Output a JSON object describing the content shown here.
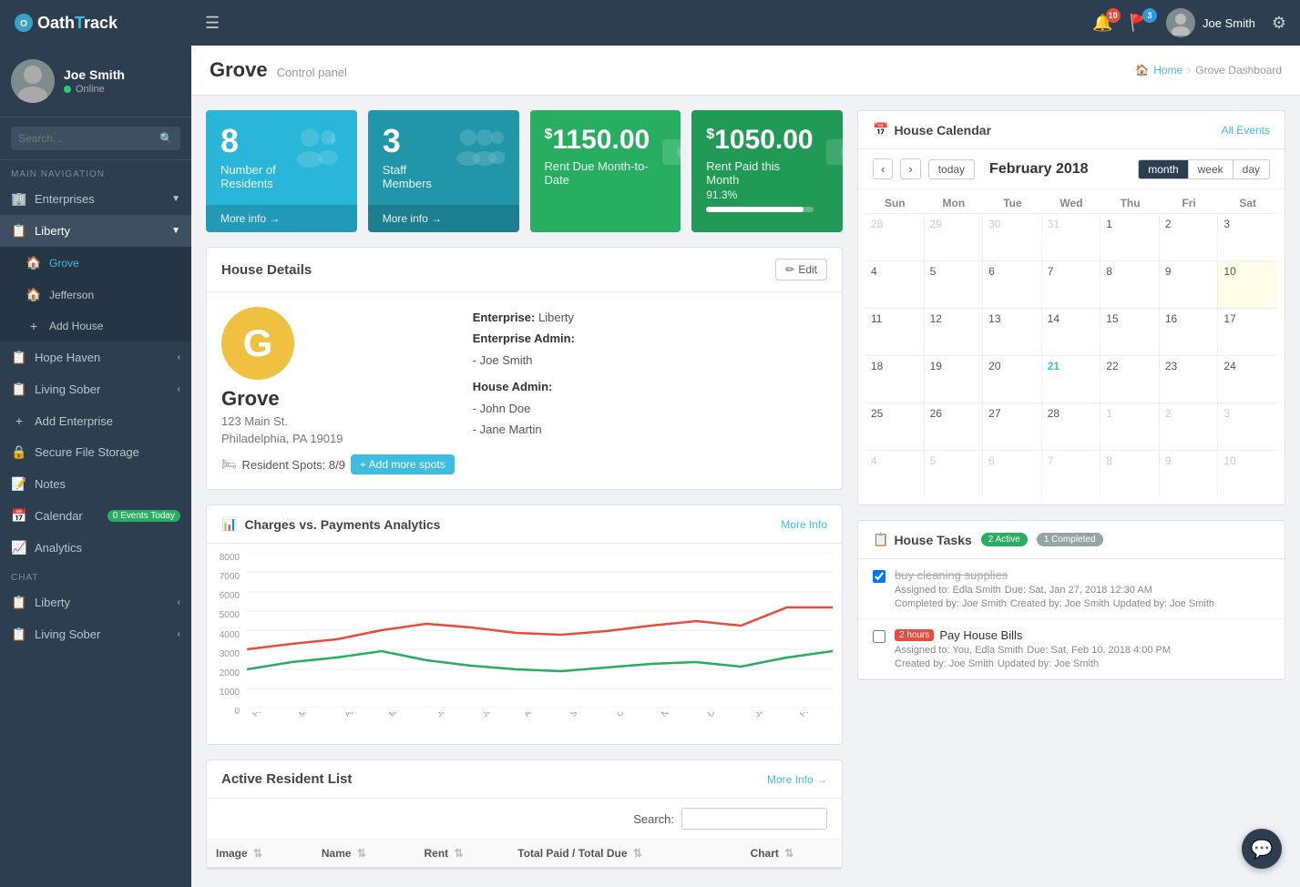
{
  "brand": {
    "oath": "Oath",
    "separator": "T",
    "track": "rack"
  },
  "topnav": {
    "hamburger": "☰",
    "notif_count": "10",
    "flag_count": "3",
    "user_name": "Joe Smith",
    "settings_icon": "⚙"
  },
  "sidebar": {
    "user": {
      "name": "Joe Smith",
      "status": "Online"
    },
    "search_placeholder": "Search...",
    "main_nav_label": "MAIN NAVIGATION",
    "items": [
      {
        "id": "enterprises",
        "label": "Enterprises",
        "icon": "🏢",
        "has_arrow": true
      },
      {
        "id": "liberty",
        "label": "Liberty",
        "icon": "📋",
        "has_arrow": true,
        "active": true
      },
      {
        "id": "grove",
        "label": "Grove",
        "icon": "🏠",
        "sub": true,
        "active_sub": true
      },
      {
        "id": "jefferson",
        "label": "Jefferson",
        "icon": "🏠",
        "sub": true
      },
      {
        "id": "add-house",
        "label": "Add House",
        "icon": "+",
        "sub": true
      },
      {
        "id": "hope-haven",
        "label": "Hope Haven",
        "icon": "📋",
        "has_arrow": true
      },
      {
        "id": "living-sober",
        "label": "Living Sober",
        "icon": "📋",
        "has_arrow": true
      },
      {
        "id": "add-enterprise",
        "label": "Add Enterprise",
        "icon": "+"
      }
    ],
    "secure_file": "Secure File Storage",
    "notes": "Notes",
    "calendar": "Calendar",
    "calendar_badge": "0 Events Today",
    "analytics": "Analytics",
    "chat_label": "Chat",
    "chat_items": [
      {
        "id": "liberty-chat",
        "label": "Liberty",
        "icon": "📋",
        "has_arrow": true
      },
      {
        "id": "living-sober-chat",
        "label": "Living Sober",
        "icon": "📋",
        "has_arrow": true
      }
    ]
  },
  "main_header": {
    "title": "Grove",
    "subtitle": "Control panel",
    "breadcrumb_home": "Home",
    "breadcrumb_current": "Grove Dashboard"
  },
  "stat_cards": [
    {
      "number": "8",
      "label": "Number of Residents",
      "footer": "More info →",
      "color": "blue"
    },
    {
      "number": "3",
      "label": "Staff Members",
      "footer": "More info →",
      "color": "blue-dark"
    },
    {
      "dollar": "$",
      "amount": "1150.00",
      "label": "Rent Due Month-to-Date",
      "color": "green"
    },
    {
      "dollar": "$",
      "amount": "1050.00",
      "label": "Rent Paid this Month",
      "pct": "91.3%",
      "progress": 91.3,
      "color": "green-dark"
    }
  ],
  "house_details": {
    "title": "House Details",
    "edit_label": "Edit",
    "logo_letter": "G",
    "house_name": "Grove",
    "address1": "123 Main St.",
    "address2": "Philadelphia, PA 19019",
    "enterprise_label": "Enterprise:",
    "enterprise_value": "Liberty",
    "enterprise_admin_label": "Enterprise Admin:",
    "enterprise_admin1": "- Joe Smith",
    "house_admin_label": "House Admin:",
    "house_admin1": "- John Doe",
    "house_admin2": "- Jane Martin",
    "spots_label": "Resident Spots: 8/9",
    "add_spots_label": "+ Add more spots"
  },
  "chart": {
    "title": "Charges vs. Payments Analytics",
    "more_info": "More Info",
    "y_labels": [
      "8000",
      "7000",
      "6000",
      "5000",
      "4000",
      "3000",
      "2000",
      "1000",
      "0"
    ],
    "x_labels": [
      "Feb 2017",
      "Mar 2017",
      "Apr 2017",
      "May 2017",
      "Jun 2017",
      "Jul 2017",
      "Aug 2017",
      "Sep 2017",
      "Oct 2017",
      "Nov 2017",
      "Dec 2017",
      "Jan 2018",
      "Feb 2018"
    ]
  },
  "resident_list": {
    "title": "Active Resident List",
    "more_info": "More Info →",
    "search_label": "Search:",
    "columns": [
      "Image",
      "Name",
      "Rent",
      "Total Paid / Total Due",
      "Chart"
    ]
  },
  "calendar": {
    "title": "House Calendar",
    "all_events": "All Events",
    "prev": "‹",
    "next": "›",
    "today": "today",
    "month_label": "February 2018",
    "view_month": "month",
    "view_week": "week",
    "view_day": "day",
    "day_headers": [
      "Sun",
      "Mon",
      "Tue",
      "Wed",
      "Thu",
      "Fri",
      "Sat"
    ],
    "weeks": [
      [
        {
          "num": "28",
          "other": true
        },
        {
          "num": "29",
          "other": true
        },
        {
          "num": "30",
          "other": true
        },
        {
          "num": "31",
          "other": true
        },
        {
          "num": "1"
        },
        {
          "num": "2"
        },
        {
          "num": "3"
        }
      ],
      [
        {
          "num": "4"
        },
        {
          "num": "5"
        },
        {
          "num": "6"
        },
        {
          "num": "7"
        },
        {
          "num": "8"
        },
        {
          "num": "9"
        },
        {
          "num": "10",
          "today": true
        }
      ],
      [
        {
          "num": "11"
        },
        {
          "num": "12"
        },
        {
          "num": "13"
        },
        {
          "num": "14"
        },
        {
          "num": "15"
        },
        {
          "num": "16"
        },
        {
          "num": "17"
        }
      ],
      [
        {
          "num": "18"
        },
        {
          "num": "19"
        },
        {
          "num": "20"
        },
        {
          "num": "21",
          "highlighted": true
        },
        {
          "num": "22"
        },
        {
          "num": "23"
        },
        {
          "num": "24"
        }
      ],
      [
        {
          "num": "25"
        },
        {
          "num": "26"
        },
        {
          "num": "27"
        },
        {
          "num": "28"
        },
        {
          "num": "1",
          "other": true
        },
        {
          "num": "2",
          "other": true
        },
        {
          "num": "3",
          "other": true
        }
      ],
      [
        {
          "num": "4",
          "other": true
        },
        {
          "num": "5",
          "other": true
        },
        {
          "num": "6",
          "other": true
        },
        {
          "num": "7",
          "other": true
        },
        {
          "num": "8",
          "other": true
        },
        {
          "num": "9",
          "other": true
        },
        {
          "num": "10",
          "other": true
        }
      ]
    ]
  },
  "tasks": {
    "title": "House Tasks",
    "active_badge": "2 Active",
    "completed_badge": "1 Completed",
    "items": [
      {
        "id": "task1",
        "completed": true,
        "title": "buy cleaning supplies",
        "assigned": "Assigned to: Edla Smith",
        "due": "Due: Sat, Jan 27, 2018 12:30 AM",
        "completed_by": "Completed by: Joe Smith",
        "created": "Created by: Joe Smith",
        "updated": "Updated by: Joe Smith"
      },
      {
        "id": "task2",
        "completed": false,
        "hours_badge": "2 hours",
        "title": "Pay House Bills",
        "assigned": "Assigned to: You, Edla Smith",
        "due": "Due: Sat, Feb 10, 2018 4:00 PM",
        "created": "Created by: Joe Smith",
        "updated": "Updated by: Joe Smith"
      }
    ]
  },
  "icons": {
    "home": "🏠",
    "calendar_icon": "📅",
    "tasks_icon": "📋",
    "chart_icon": "📊",
    "user_icon": "👤",
    "security_icon": "🔒",
    "notes_icon": "📝",
    "analytics_icon": "📈",
    "chat_icon": "💬"
  },
  "colors": {
    "primary_blue": "#29b6d8",
    "primary_blue_dark": "#2196a8",
    "primary_green": "#27ae60",
    "primary_green_dark": "#219a55",
    "sidebar_bg": "#2c3e50",
    "accent": "#3dbde2"
  }
}
